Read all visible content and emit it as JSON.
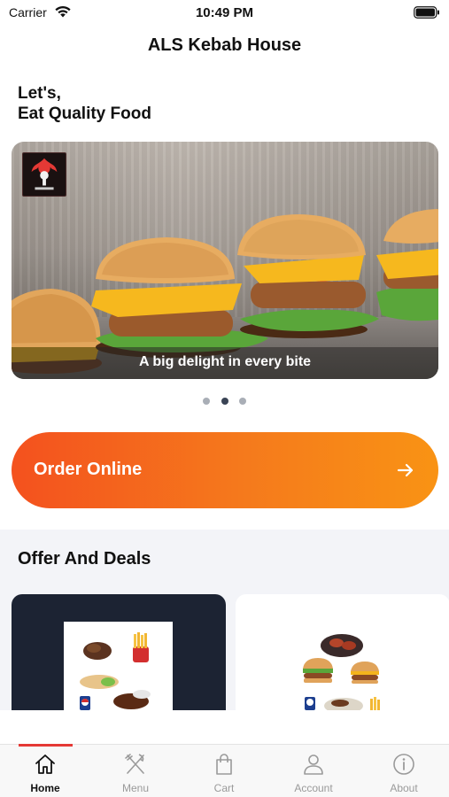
{
  "status_bar": {
    "carrier": "Carrier",
    "time": "10:49 PM"
  },
  "nav": {
    "title": "ALS Kebab House"
  },
  "greeting": {
    "line1": "Let's,",
    "line2": "Eat Quality Food"
  },
  "hero": {
    "caption": "A big delight in every bite",
    "logo_icon": "kebab-house-logo",
    "active_slide": 2,
    "slide_count": 3
  },
  "order": {
    "label": "Order Online",
    "icon": "arrow-right-icon",
    "gradient": [
      "#f4511e",
      "#f99314"
    ]
  },
  "offers": {
    "title": "Offer And Deals"
  },
  "tab_bar": {
    "active": "Home",
    "accent": "#e53935",
    "items": [
      {
        "label": "Home",
        "icon": "home-icon"
      },
      {
        "label": "Menu",
        "icon": "fork-knife-icon"
      },
      {
        "label": "Cart",
        "icon": "shopping-bag-icon"
      },
      {
        "label": "Account",
        "icon": "user-icon"
      },
      {
        "label": "About",
        "icon": "info-icon"
      }
    ]
  }
}
